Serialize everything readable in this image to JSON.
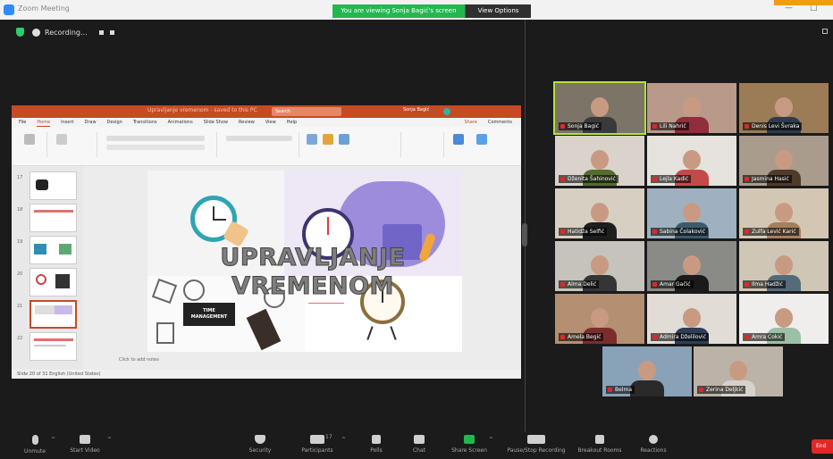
{
  "window": {
    "title": "Zoom Meeting",
    "controls": [
      "—",
      "□"
    ]
  },
  "share_banner": {
    "message": "You are viewing Sonja Bagić's screen",
    "options_label": "View Options"
  },
  "recording": {
    "label": "Recording..."
  },
  "powerpoint": {
    "title": "Upravljanje vremenom - saved to this PC",
    "search_placeholder": "Search",
    "user": "Sonja Bagić",
    "menu": [
      "File",
      "Home",
      "Insert",
      "Draw",
      "Design",
      "Transitions",
      "Animations",
      "Slide Show",
      "Review",
      "View",
      "Help"
    ],
    "active_menu": "Home",
    "share_label": "Share",
    "comments_label": "Comments",
    "slide_numbers": [
      "17",
      "18",
      "19",
      "20",
      "21",
      "22"
    ],
    "notes_hint": "Click to add notes",
    "status": "Slide 20 of 31   English (United States)",
    "slide": {
      "title_line1": "UPRAVLJANJE",
      "title_line2": "VREMENOM",
      "card_line1": "TIME",
      "card_line2": "MANAGEMENT"
    }
  },
  "participants": [
    {
      "name": "Sonja Bagić",
      "wall": "#7c7466",
      "shirt": "#3a3a3a",
      "active": true
    },
    {
      "name": "Lili Nahrić",
      "wall": "#b99a8a",
      "shirt": "#8e2f3b",
      "active": false
    },
    {
      "name": "Denis Levi Švraka",
      "wall": "#9c7c57",
      "shirt": "#2f3b4d",
      "active": false
    },
    {
      "name": "Dženita Šahinović",
      "wall": "#d9d3cb",
      "shirt": "#556b2f",
      "active": false
    },
    {
      "name": "Lejla Kadić",
      "wall": "#e6e2dd",
      "shirt": "#c44a4a",
      "active": false
    },
    {
      "name": "Jasmina Hasić",
      "wall": "#aa9c8c",
      "shirt": "#4e3b2a",
      "active": false
    },
    {
      "name": "Hatidža Selfić",
      "wall": "#d8cfc3",
      "shirt": "#1e1e1e",
      "active": false
    },
    {
      "name": "Sabina Čolaković",
      "wall": "#9fb1c1",
      "shirt": "#3d5a6c",
      "active": false
    },
    {
      "name": "Zulfa Lević Karić",
      "wall": "#d3c7b4",
      "shirt": "#a87f5c",
      "active": false
    },
    {
      "name": "Alma Delić",
      "wall": "#c6c2bc",
      "shirt": "#353535",
      "active": false
    },
    {
      "name": "Amar Gačić",
      "wall": "#8a8a86",
      "shirt": "#1a1a1a",
      "active": false
    },
    {
      "name": "Ilma Hadžić",
      "wall": "#cfc6b5",
      "shirt": "#566b7a",
      "active": false
    },
    {
      "name": "Amela Begić",
      "wall": "#b48f71",
      "shirt": "#7b2d2d",
      "active": false
    },
    {
      "name": "Admira Dželilović",
      "wall": "#e1dcd5",
      "shirt": "#2e3d58",
      "active": false
    },
    {
      "name": "Amra Cokić",
      "wall": "#efeeec",
      "shirt": "#9dbfa6",
      "active": false
    },
    {
      "name": "Belma",
      "wall": "#8aa2b8",
      "shirt": "#2a2a2a",
      "active": false
    },
    {
      "name": "Zerina Deljkić",
      "wall": "#bbb3a8",
      "shirt": "#d6d1c9",
      "active": false
    }
  ],
  "toolbar": {
    "unmute": "Unmute",
    "start_video": "Start Video",
    "security": "Security",
    "participants": "Participants",
    "participant_count": "17",
    "polls": "Polls",
    "chat": "Chat",
    "share_screen": "Share Screen",
    "pause_recording": "Pause/Stop Recording",
    "breakout_rooms": "Breakout Rooms",
    "reactions": "Reactions",
    "end": "End"
  }
}
